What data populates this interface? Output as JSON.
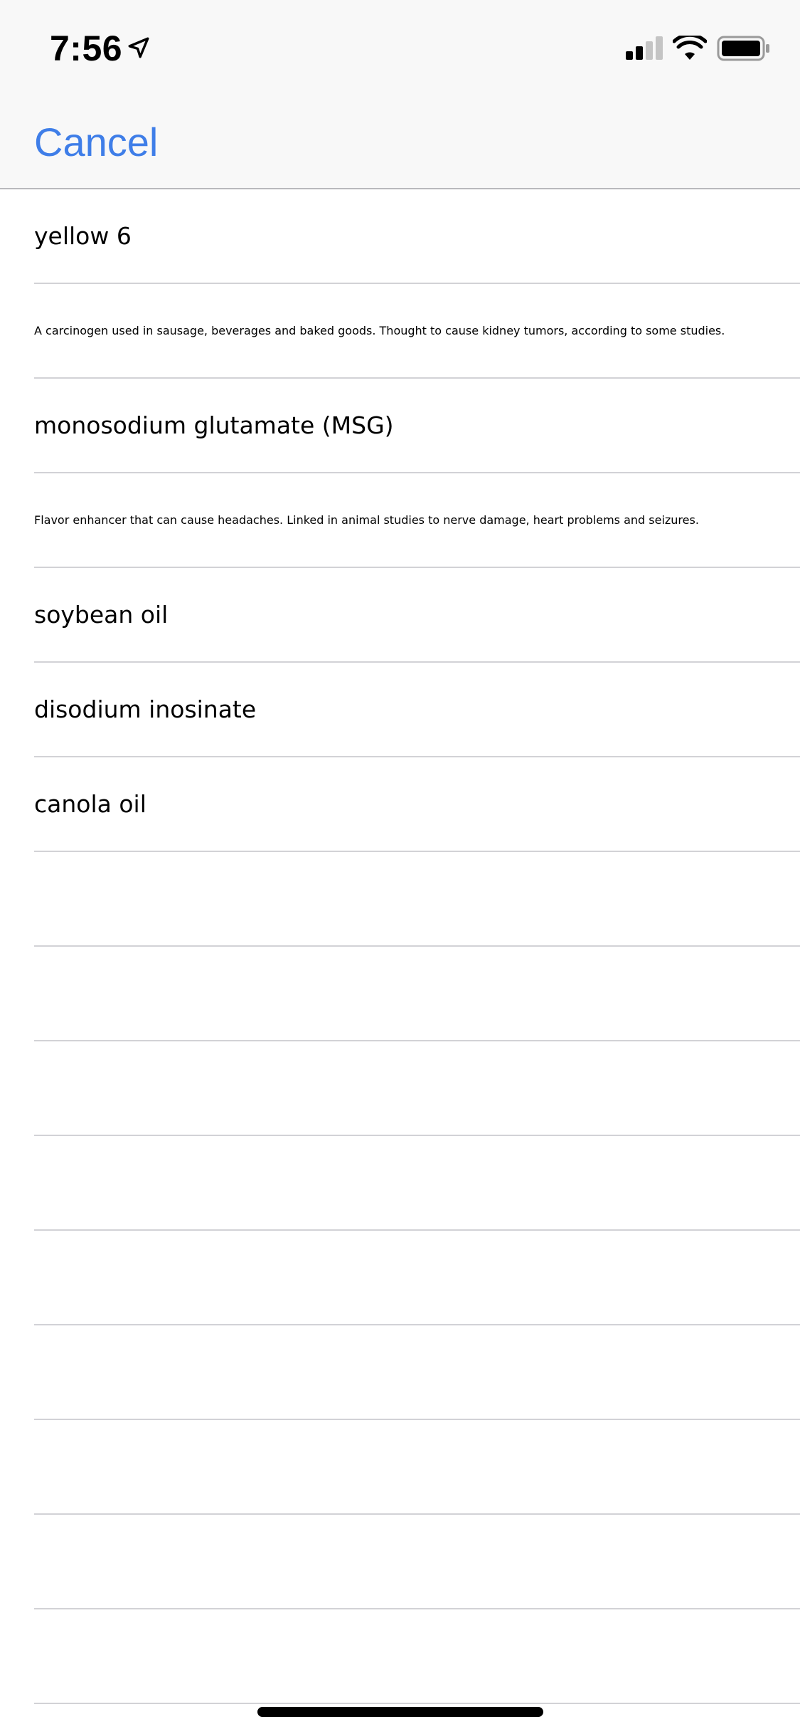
{
  "status_bar": {
    "time": "7:56",
    "icons": [
      "location-arrow-icon",
      "cellular-signal-icon",
      "wifi-icon",
      "battery-icon"
    ]
  },
  "nav": {
    "cancel_label": "Cancel",
    "accent_color": "#3f7ee8"
  },
  "list": {
    "items": [
      {
        "text": "yellow 6",
        "kind": "title"
      },
      {
        "text": "A carcinogen used in sausage, beverages and baked goods. Thought to cause kidney tumors, according to some studies.",
        "kind": "description"
      },
      {
        "text": "monosodium glutamate (MSG)",
        "kind": "title"
      },
      {
        "text": "Flavor enhancer that can cause headaches. Linked in animal studies to nerve damage, heart problems and seizures.",
        "kind": "description"
      },
      {
        "text": "soybean oil",
        "kind": "title"
      },
      {
        "text": "disodium inosinate",
        "kind": "title"
      },
      {
        "text": "canola oil",
        "kind": "title"
      },
      {
        "text": "",
        "kind": "empty"
      },
      {
        "text": "",
        "kind": "empty"
      },
      {
        "text": "",
        "kind": "empty"
      },
      {
        "text": "",
        "kind": "empty"
      },
      {
        "text": "",
        "kind": "empty"
      },
      {
        "text": "",
        "kind": "empty"
      },
      {
        "text": "",
        "kind": "empty"
      },
      {
        "text": "",
        "kind": "empty"
      },
      {
        "text": "",
        "kind": "empty"
      }
    ]
  }
}
